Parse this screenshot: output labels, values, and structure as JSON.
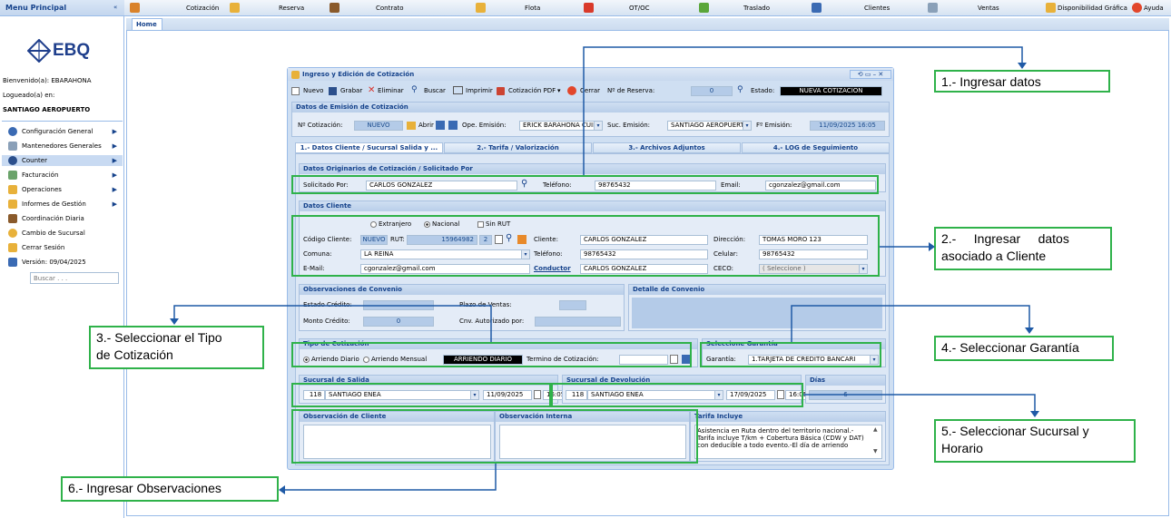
{
  "sidebar": {
    "title": "Menu Principal",
    "logo_text": "EBQ",
    "welcome": "Bienvenido(a): EBARAHONA",
    "logged_in": "Logueado(a) en:",
    "location": "SANTIAGO AEROPUERTO",
    "items": [
      {
        "label": "Configuración General",
        "icon": "gear-icon",
        "arrow": true
      },
      {
        "label": "Mantenedores Generales",
        "icon": "table-icon",
        "arrow": true
      },
      {
        "label": "Counter",
        "icon": "car-icon",
        "arrow": true
      },
      {
        "label": "Facturación",
        "icon": "invoice-icon",
        "arrow": true
      },
      {
        "label": "Operaciones",
        "icon": "folder-icon",
        "arrow": true
      },
      {
        "label": "Informes de Gestión",
        "icon": "chart-icon",
        "arrow": true
      },
      {
        "label": "Coordinación Diaria",
        "icon": "people-icon",
        "arrow": false
      },
      {
        "label": "Cambio de Sucursal",
        "icon": "refresh-icon",
        "arrow": false
      },
      {
        "label": "Cerrar Sesión",
        "icon": "lock-icon",
        "arrow": false
      },
      {
        "label": "Versión: 09/04/2025",
        "icon": "calendar-icon",
        "arrow": false
      }
    ],
    "search_placeholder": "Buscar . . ."
  },
  "toolbar": {
    "items": [
      "Cotización",
      "Reserva",
      "Contrato",
      "Flota",
      "OT/OC",
      "Traslado",
      "Clientes",
      "Ventas"
    ],
    "availability": "Disponibilidad Gráfica",
    "help": "Ayuda"
  },
  "tabs": {
    "home": "Home"
  },
  "dialog": {
    "title": "Ingreso y Edición de Cotización",
    "buttons": {
      "new": "Nuevo",
      "save": "Grabar",
      "delete": "Eliminar",
      "search": "Buscar",
      "print": "Imprimir",
      "pdf": "Cotización PDF",
      "close": "Cerrar"
    },
    "reserva_label": "Nº de Reserva:",
    "reserva_value": "0",
    "estado_label": "Estado:",
    "estado_value": "NUEVA COTIZACION",
    "emision": {
      "header": "Datos de Emisión de Cotización",
      "cot_label": "Nº Cotización:",
      "cot_value": "NUEVO",
      "open": "Abrir",
      "ope_label": "Ope. Emisión:",
      "ope_value": "ERICK BARAHONA CUIR",
      "suc_label": "Suc. Emisión:",
      "suc_value": "SANTIAGO AEROPUERTO",
      "fecha_label": "Fº Emisión:",
      "fecha_value": "11/09/2025 16:05"
    },
    "tabs": [
      "1.- Datos Cliente / Sucursal Salida y ...",
      "2.- Tarifa / Valorización",
      "3.- Archivos Adjuntos",
      "4.- LOG de Seguimiento"
    ],
    "origen": {
      "header": "Datos Originarios de Cotización / Solicitado Por",
      "solicitado_label": "Solicitado Por:",
      "solicitado_value": "CARLOS GONZALEZ",
      "telefono_label": "Teléfono:",
      "telefono_value": "98765432",
      "email_label": "Email:",
      "email_value": "cgonzalez@gmail.com"
    },
    "cliente": {
      "header": "Datos Cliente",
      "radio_extranjero": "Extranjero",
      "radio_nacional": "Nacional",
      "sin_rut": "Sin RUT",
      "codigo_label": "Código Cliente:",
      "codigo_value": "NUEVO",
      "rut_label": "RUT:",
      "rut_value": "15964982",
      "rut_dv": "2",
      "cliente_label": "Cliente:",
      "cliente_value": "CARLOS GONZALEZ",
      "direccion_label": "Dirección:",
      "direccion_value": "TOMAS MORO 123",
      "comuna_label": "Comuna:",
      "comuna_value": "LA REINA",
      "telefono_label": "Teléfono:",
      "telefono_value": "98765432",
      "celular_label": "Celular:",
      "celular_value": "98765432",
      "email_label": "E-Mail:",
      "email_value": "cgonzalez@gmail.com",
      "conductor_label": "Conductor",
      "conductor_value": "CARLOS GONZALEZ",
      "ceco_label": "CECO:",
      "ceco_value": "( Seleccione )"
    },
    "convenio": {
      "header": "Observaciones de Convenio",
      "estado_label": "Estado Crédito:",
      "plazo_label": "Plazo de Ventas:",
      "monto_label": "Monto Crédito:",
      "monto_value": "0",
      "cnv_label": "Cnv. Autorizado por:",
      "detalle_header": "Detalle de Convenio"
    },
    "tipo": {
      "header": "Tipo de Cotización",
      "radio_diario": "Arriendo Diario",
      "radio_mensual": "Arriendo Mensual",
      "selected": "ARRIENDO DIARIO",
      "termino_label": "Termino de Cotización:"
    },
    "garantia": {
      "header": "Seleccione Garantía",
      "label": "Garantía:",
      "value": "1.TARJETA DE CREDITO BANCARI"
    },
    "salida": {
      "header": "Sucursal de Salida",
      "code": "118",
      "name": "SANTIAGO ENEA",
      "date": "11/09/2025",
      "time": "16:05"
    },
    "devolucion": {
      "header": "Sucursal de Devolución",
      "code": "118",
      "name": "SANTIAGO ENEA",
      "date": "17/09/2025",
      "time": "16:05"
    },
    "dias": {
      "header": "Días",
      "value": "6"
    },
    "obs_cliente_header": "Observación de Cliente",
    "obs_interna_header": "Observación Interna",
    "tarifa_header": "Tarifa Incluye",
    "tarifa_text": "Asistencia en Ruta dentro del territorio nacional.- Tarifa incluye T/km + Cobertura Básica (CDW y DAT) con deducible a todo evento.-El día de arriendo"
  },
  "callouts": {
    "c1": "1.- Ingresar datos",
    "c2a": "2.-     Ingresar     datos",
    "c2b": "asociado a Cliente",
    "c3a": "3.- Seleccionar el Tipo",
    "c3b": "de Cotización",
    "c4": "4.- Seleccionar Garantía",
    "c5a": "5.- Seleccionar Sucursal y",
    "c5b": "Horario",
    "c6": "6.- Ingresar Observaciones"
  },
  "colors": {
    "annotation_green": "#2fb24a",
    "arrow_blue": "#1f5aa6",
    "ui_blue": "#15428b"
  }
}
